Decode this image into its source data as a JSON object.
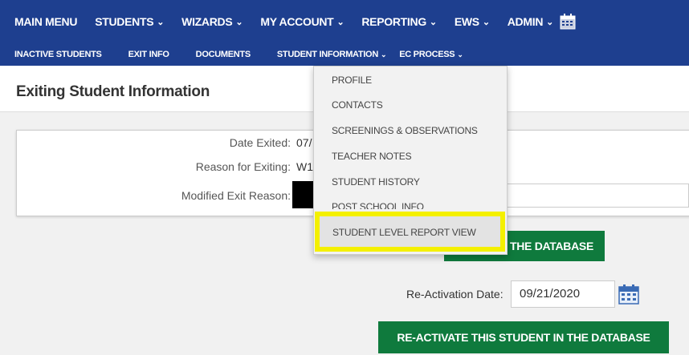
{
  "nav": {
    "main": [
      {
        "label": "MAIN MENU",
        "chevron": false
      },
      {
        "label": "STUDENTS",
        "chevron": true
      },
      {
        "label": "WIZARDS",
        "chevron": true
      },
      {
        "label": "MY ACCOUNT",
        "chevron": true
      },
      {
        "label": "REPORTING",
        "chevron": true
      },
      {
        "label": "EWS",
        "chevron": true
      },
      {
        "label": "ADMIN",
        "chevron": true
      }
    ],
    "sub": [
      {
        "label": "INACTIVE STUDENTS",
        "chevron": false
      },
      {
        "label": "EXIT INFO",
        "chevron": false
      },
      {
        "label": "DOCUMENTS",
        "chevron": false
      },
      {
        "label": "STUDENT INFORMATION",
        "chevron": true
      },
      {
        "label": "EC PROCESS",
        "chevron": true
      }
    ],
    "chevron_glyph": "⌄"
  },
  "page": {
    "title": "Exiting Student Information"
  },
  "exit_info": {
    "date_exited_label": "Date Exited:",
    "date_exited_value": "07/",
    "reason_label": "Reason for Exiting:",
    "reason_value": "W1",
    "modified_reason_label": "Modified Exit Reason:"
  },
  "buttons": {
    "db_button_label": "THE DATABASE",
    "reactivate_label": "RE-ACTIVATE THIS STUDENT IN THE DATABASE"
  },
  "reactivation": {
    "label": "Re-Activation Date:",
    "value": "09/21/2020"
  },
  "dropdown": {
    "items": [
      "PROFILE",
      "CONTACTS",
      "SCREENINGS & OBSERVATIONS",
      "TEACHER NOTES",
      "STUDENT HISTORY",
      "POST SCHOOL INFO",
      "STUDENT LEVEL REPORT VIEW"
    ]
  },
  "colors": {
    "nav_bg": "#1e3f8f",
    "button_green": "#0f7a3d",
    "highlight": "#f4f000"
  }
}
